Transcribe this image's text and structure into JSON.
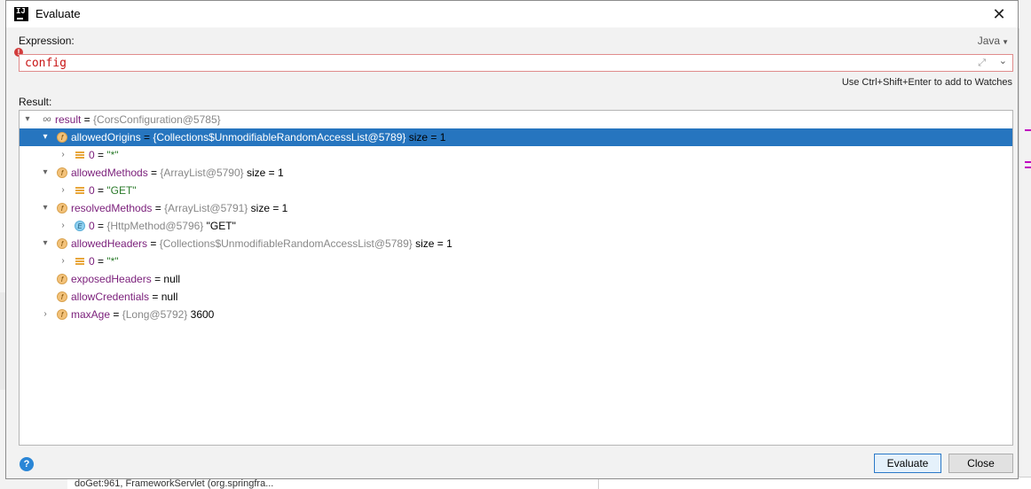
{
  "window": {
    "title": "Evaluate",
    "close_symbol": "✕"
  },
  "expression": {
    "label": "Expression:",
    "language": "Java",
    "value": "config",
    "hint": "Use Ctrl+Shift+Enter to add to Watches",
    "error_symbol": "!"
  },
  "result": {
    "label": "Result:",
    "rows": [
      {
        "arrow": "▾",
        "icon": "watch",
        "name": "result",
        "eq": " = ",
        "type": "{CorsConfiguration@5785}",
        "value": "",
        "extra": ""
      },
      {
        "arrow": "▾",
        "icon": "field",
        "name": "allowedOrigins",
        "eq": " = ",
        "type": "{Collections$UnmodifiableRandomAccessList@5789}",
        "value": "",
        "extra": "  size = 1",
        "selected": true
      },
      {
        "arrow": "›",
        "icon": "list",
        "name": "0",
        "eq": " = ",
        "type": "",
        "value": "\"*\"",
        "extra": ""
      },
      {
        "arrow": "▾",
        "icon": "field",
        "name": "allowedMethods",
        "eq": " = ",
        "type": "{ArrayList@5790}",
        "value": "",
        "extra": "  size = 1"
      },
      {
        "arrow": "›",
        "icon": "list",
        "name": "0",
        "eq": " = ",
        "type": "",
        "value": "\"GET\"",
        "extra": ""
      },
      {
        "arrow": "▾",
        "icon": "field",
        "name": "resolvedMethods",
        "eq": " = ",
        "type": "{ArrayList@5791}",
        "value": "",
        "extra": "  size = 1"
      },
      {
        "arrow": "›",
        "icon": "enum",
        "name": "0",
        "eq": " = ",
        "type": "{HttpMethod@5796}",
        "value": " \"GET\"",
        "extra": ""
      },
      {
        "arrow": "▾",
        "icon": "field",
        "name": "allowedHeaders",
        "eq": " = ",
        "type": "{Collections$UnmodifiableRandomAccessList@5789}",
        "value": "",
        "extra": "  size = 1"
      },
      {
        "arrow": "›",
        "icon": "list",
        "name": "0",
        "eq": " = ",
        "type": "",
        "value": "\"*\"",
        "extra": ""
      },
      {
        "arrow": "",
        "icon": "field",
        "name": "exposedHeaders",
        "eq": " = ",
        "type": "",
        "value": "null",
        "extra": ""
      },
      {
        "arrow": "",
        "icon": "field",
        "name": "allowCredentials",
        "eq": " = ",
        "type": "",
        "value": "null",
        "extra": ""
      },
      {
        "arrow": "›",
        "icon": "field",
        "name": "maxAge",
        "eq": " = ",
        "type": "{Long@5792}",
        "value": " 3600",
        "extra": ""
      }
    ]
  },
  "buttons": {
    "evaluate": "Evaluate",
    "close": "Close",
    "help": "?"
  },
  "background": {
    "bottom_text": "doGet:961, FrameworkServlet (org.springfra..."
  },
  "colors": {
    "selection": "#2675bf",
    "error_border": "#e08c8c",
    "expression_text": "#c81414"
  }
}
